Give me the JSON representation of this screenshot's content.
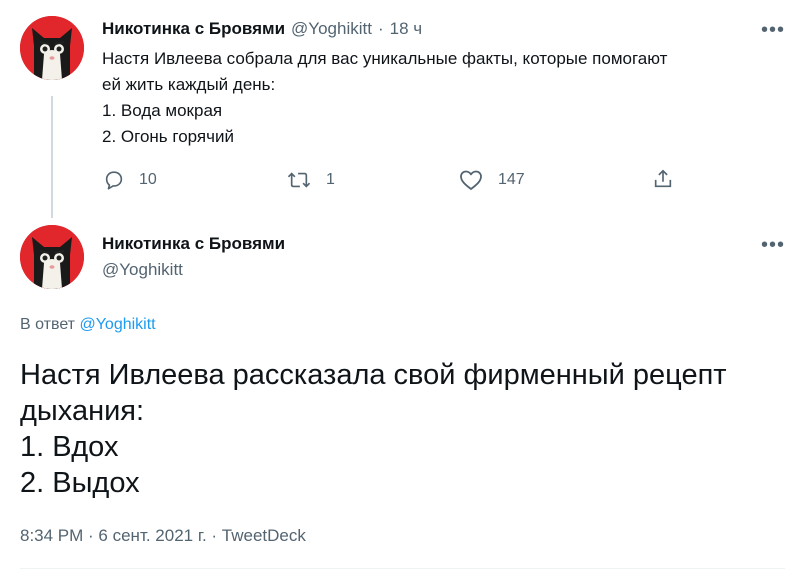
{
  "tweet1": {
    "author_name": "Никотинка с Бровями",
    "author_handle": "@Yoghikitt",
    "separator": "·",
    "time": "18 ч",
    "more": "•••",
    "lines": [
      "Настя Ивлеева собрала для вас уникальные факты, которые помогают",
      "ей жить каждый день:",
      "1. Вода мокрая",
      "2. Огонь горячий"
    ],
    "actions": {
      "reply_count": "10",
      "retweet_count": "1",
      "like_count": "147"
    }
  },
  "tweet2": {
    "author_name": "Никотинка с Бровями",
    "author_handle": "@Yoghikitt",
    "more": "•••",
    "reply_prefix": "В ответ",
    "reply_handle": "@Yoghikitt",
    "lines": [
      "Настя Ивлеева рассказала свой фирменный рецепт",
      "дыхания:",
      "1. Вдох",
      "2. Выдох"
    ],
    "meta": "8:34 PM · 6 сент. 2021 г. · TweetDeck"
  },
  "colors": {
    "avatar_bg": "#e1272c",
    "link": "#1d9bf0",
    "muted": "#536471",
    "thread_line": "#cfd9de"
  },
  "icons": [
    "avatar-cat",
    "more-dots-icon",
    "reply-icon",
    "retweet-icon",
    "like-icon",
    "share-icon"
  ]
}
